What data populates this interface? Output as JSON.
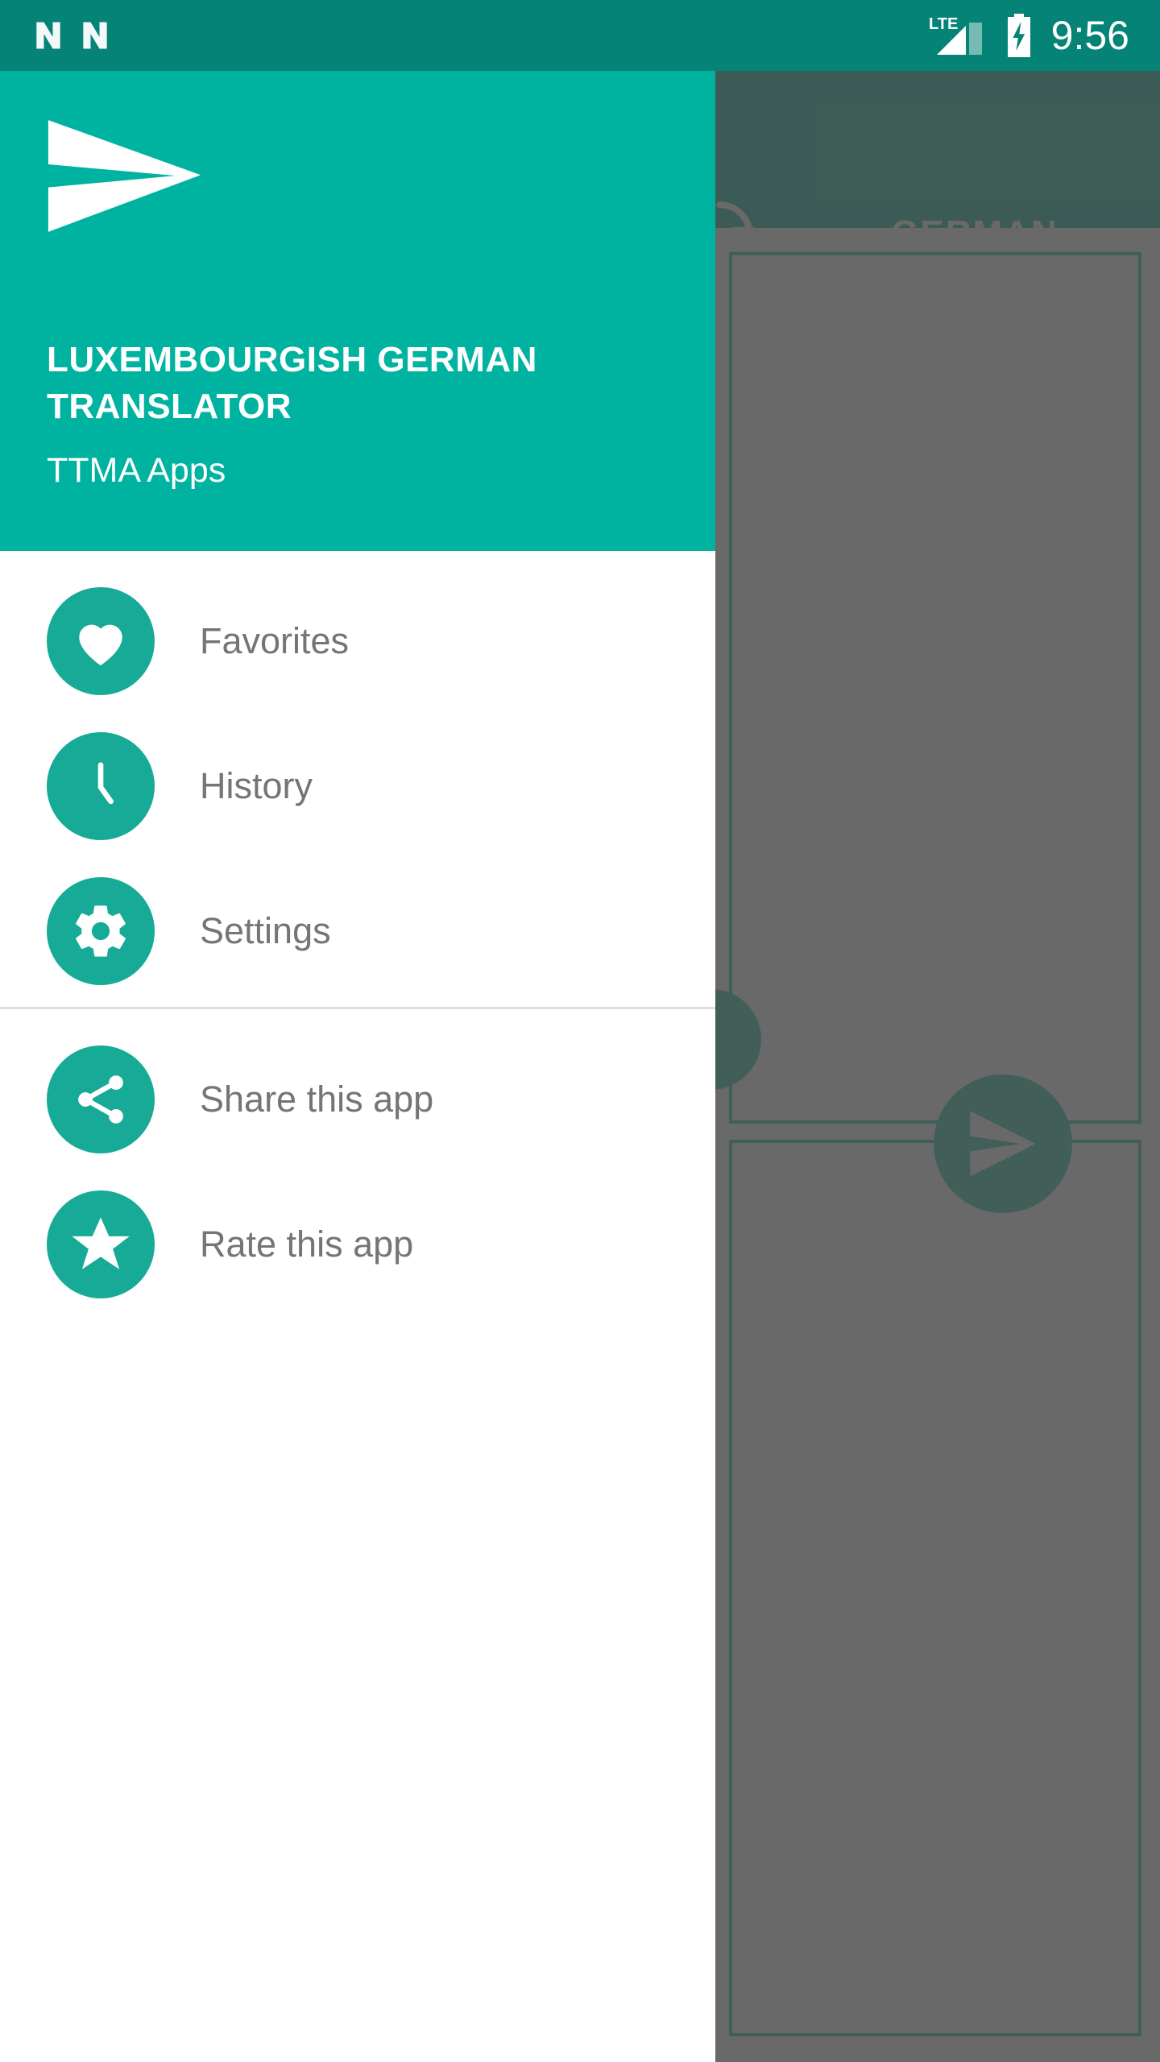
{
  "status_bar": {
    "notification_icons": [
      "android-n-icon",
      "android-n-icon"
    ],
    "network_label": "LTE",
    "signal_icon": "signal-bars-icon",
    "battery_icon": "battery-charging-icon",
    "clock": "9:56"
  },
  "background_app": {
    "swap_icon": "swap-languages-icon",
    "target_language": "GERMAN",
    "send_fab_icon": "send-icon",
    "source_panel": "source-text-panel",
    "target_panel": "target-text-panel"
  },
  "drawer": {
    "logo_icon": "paper-plane-logo",
    "title": "LUXEMBOURGISH GERMAN TRANSLATOR",
    "subtitle": "TTMA Apps",
    "primary_items": [
      {
        "label": "Favorites",
        "icon": "heart-icon"
      },
      {
        "label": "History",
        "icon": "clock-icon"
      },
      {
        "label": "Settings",
        "icon": "gear-icon"
      }
    ],
    "secondary_items": [
      {
        "label": "Share this app",
        "icon": "share-icon"
      },
      {
        "label": "Rate this app",
        "icon": "star-icon"
      }
    ]
  },
  "colors": {
    "status_bar": "#048376",
    "drawer_header": "#00b3a0",
    "icon_circle": "#17ab97",
    "toolbar_dim": "#024c3f",
    "accent_dark": "#0b5448",
    "label_text": "#757575"
  }
}
